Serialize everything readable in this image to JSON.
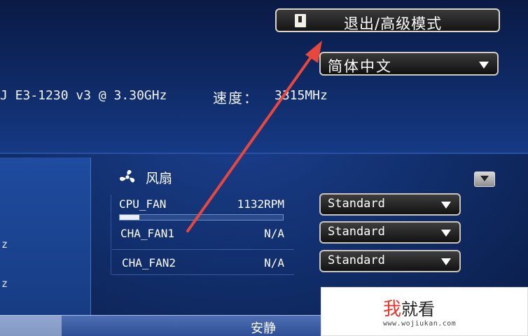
{
  "header": {
    "exit_button_label": "退出/高级模式",
    "language_selected": "简体中文"
  },
  "cpu": {
    "model_text": "J E3-1230 v3 @ 3.30GHz",
    "speed_label": "速度：",
    "speed_value": "3315MHz"
  },
  "left_panel": {
    "line1": "z",
    "line2": "z"
  },
  "fans": {
    "title": "风扇",
    "items": [
      {
        "name": "CPU_FAN",
        "speed": "1132RPM",
        "mode": "Standard",
        "level": 0.12
      },
      {
        "name": "CHA_FAN1",
        "speed": "N/A",
        "mode": "Standard"
      },
      {
        "name": "CHA_FAN2",
        "speed": "N/A",
        "mode": "Standard"
      }
    ]
  },
  "bottom": {
    "mode_label": "安静"
  },
  "watermark": {
    "brand_accent": "我",
    "brand_rest": "就看",
    "url": "www.wojiukan.com"
  },
  "colors": {
    "background": "#12306f",
    "annotation_arrow": "#e8473d",
    "button_face": "#1a1a1a"
  },
  "icons": {
    "exit": "exit-door-icon",
    "fan": "fan-icon",
    "dropdown": "caret-down-icon",
    "collapse": "chevron-down-icon"
  }
}
